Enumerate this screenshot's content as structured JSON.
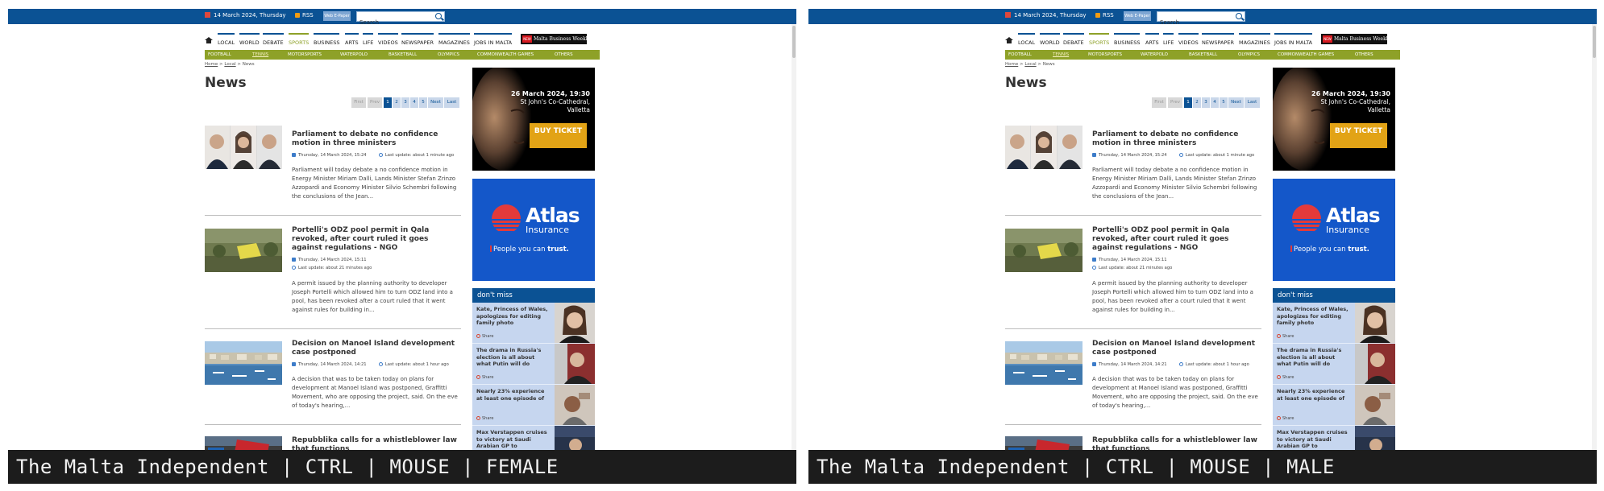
{
  "panels": [
    {
      "caption": "The Malta Independent | CTRL | MOUSE | FEMALE"
    },
    {
      "caption": "The Malta Independent | CTRL | MOUSE | MALE"
    }
  ],
  "topbar": {
    "date": "14 March 2024, Thursday",
    "rss_label": "RSS",
    "epaper_label": "Web E-Paper",
    "search_value": "Search"
  },
  "mainnav": {
    "items": [
      "LOCAL",
      "WORLD",
      "DEBATE",
      "SPORTS",
      "BUSINESS",
      "ARTS",
      "LIFE",
      "VIDEOS",
      "NEWSPAPER",
      "MAGAZINES",
      "JOBS IN MALTA"
    ],
    "mbw_new": "NEW",
    "mbw_label": "Malta Business Weekly"
  },
  "subnav": {
    "items": [
      "FOOTBALL",
      "TENNIS",
      "MOTORSPORTS",
      "WATERPOLO",
      "BASKETBALL",
      "OLYMPICS",
      "COMMONWEALTH GAMES",
      "OTHERS"
    ]
  },
  "breadcrumb": {
    "home": "Home",
    "local": "Local",
    "current": "News",
    "sep": ">"
  },
  "page_title": "News",
  "pager": {
    "first": "First",
    "prev": "Prev",
    "pages": [
      "1",
      "2",
      "3",
      "4",
      "5"
    ],
    "next": "Next",
    "last": "Last"
  },
  "articles": [
    {
      "title": "Parliament to debate no confidence motion in three ministers",
      "date": "Thursday, 14 March 2024, 15:24",
      "update": "Last update: about 1 minute ago",
      "excerpt": "Parliament will today debate a no confidence motion in Energy Minister Miriam Dalli, Lands Minister Stefan Zrinzo Azzopardi and Economy Minister Silvio Schembri following the conclusions of the Jean..."
    },
    {
      "title": "Portelli's ODZ pool permit in Qala revoked, after court ruled it goes against regulations - NGO",
      "date": "Thursday, 14 March 2024, 15:11",
      "update": "Last update: about 21 minutes ago",
      "excerpt": "A permit issued by the planning authority to developer Joseph Portelli which allowed him to turn ODZ land into a pool, has been revoked after a court ruled that it went against rules for building in..."
    },
    {
      "title": "Decision on Manoel Island development case postponed",
      "date": "Thursday, 14 March 2024, 14:21",
      "update": "Last update: about 1 hour ago",
      "excerpt": "A decision that was to be taken today on plans for development at Manoel Island was postponed, Graffitti Movement, who are opposing the project, said. On the eve of today's hearing,..."
    },
    {
      "title": "Repubblika calls for a whistleblower law that functions",
      "thumb_label": "open"
    }
  ],
  "ads": {
    "concert_date": "26 March 2024, 19:30",
    "concert_venue": "St John's Co-Cathedral, Valletta",
    "buy_label": "BUY TICKET",
    "atlas_word1": "Atlas",
    "atlas_word2": "Insurance",
    "atlas_tag_a": "People you can ",
    "atlas_tag_b": "trust."
  },
  "dont_miss": {
    "header": "don't miss",
    "share_label": "Share",
    "items": [
      {
        "title": "Kate, Princess of Wales, apologizes for editing family photo"
      },
      {
        "title": "The drama in Russia's election is all about what Putin will do"
      },
      {
        "title": "Nearly 23% experience at least one episode of"
      },
      {
        "title": "Max Verstappen cruises to victory at Saudi Arabian GP to"
      }
    ]
  },
  "colors": {
    "brand_blue": "#0b5294",
    "sports_green": "#8ea128",
    "buy_orange": "#e2a316",
    "atlas_blue": "#1457c9"
  }
}
